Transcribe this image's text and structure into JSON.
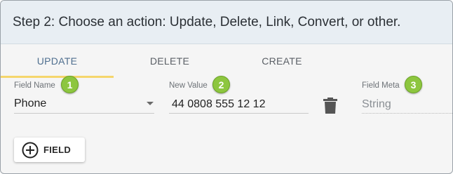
{
  "header": {
    "title": "Step 2: Choose an action: Update, Delete, Link, Convert, or other."
  },
  "tabs": [
    {
      "label": "UPDATE",
      "active": true
    },
    {
      "label": "DELETE",
      "active": false
    },
    {
      "label": "CREATE",
      "active": false
    }
  ],
  "form": {
    "field_name": {
      "label": "Field Name",
      "value": "Phone",
      "badge": "1"
    },
    "new_value": {
      "label": "New Value",
      "value": "44 0808 555 12 12",
      "badge": "2"
    },
    "field_meta": {
      "label": "Field Meta",
      "value": "String",
      "badge": "3"
    }
  },
  "actions": {
    "add_field_label": "FIELD"
  },
  "colors": {
    "accent_underline": "#f5d66c",
    "badge": "#8dc63f",
    "active_tab_text": "#4f6f8f"
  }
}
